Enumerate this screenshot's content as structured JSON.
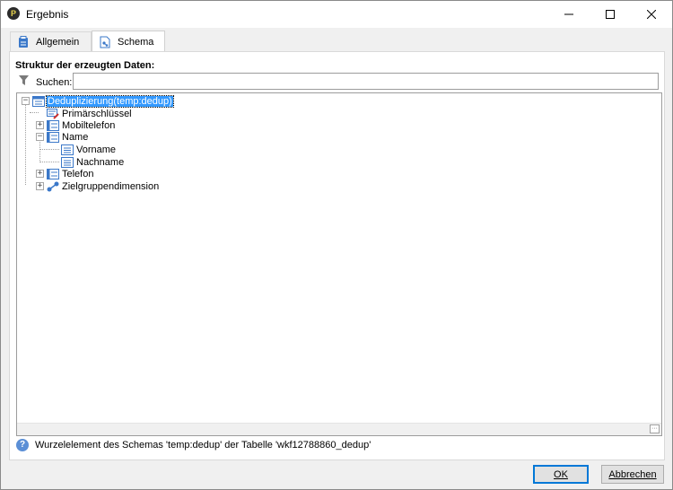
{
  "window": {
    "title": "Ergebnis",
    "app_icon_glyph": "P",
    "icon": "app-logo-icon"
  },
  "tabs": [
    {
      "label": "Allgemein",
      "icon": "clipboard-icon",
      "active": false
    },
    {
      "label": "Schema",
      "icon": "schema-icon",
      "active": true
    }
  ],
  "schema": {
    "section_title": "Struktur der erzeugten Daten:",
    "search": {
      "label": "Suchen:",
      "value": "",
      "placeholder": ""
    },
    "tree": [
      {
        "label": "Deduplizierung(temp:dedup)",
        "icon": "table-element-icon",
        "expanded": true,
        "selected": true,
        "level": 0
      },
      {
        "label": "Primärschlüssel",
        "icon": "primary-key-icon",
        "expanded": null,
        "selected": false,
        "level": 1
      },
      {
        "label": "Mobiltelefon",
        "icon": "element-icon",
        "expanded": false,
        "selected": false,
        "level": 1
      },
      {
        "label": "Name",
        "icon": "element-icon",
        "expanded": true,
        "selected": false,
        "level": 1
      },
      {
        "label": "Vorname",
        "icon": "field-icon",
        "expanded": null,
        "selected": false,
        "level": 2
      },
      {
        "label": "Nachname",
        "icon": "field-icon",
        "expanded": null,
        "selected": false,
        "level": 2
      },
      {
        "label": "Telefon",
        "icon": "element-icon",
        "expanded": false,
        "selected": false,
        "level": 1
      },
      {
        "label": "Zielgruppendimension",
        "icon": "link-icon",
        "expanded": false,
        "selected": false,
        "level": 1
      }
    ],
    "status_text": "Wurzelelement des Schemas 'temp:dedup' der Tabelle 'wkf12788860_dedup'"
  },
  "buttons": {
    "ok": "OK",
    "cancel": "Abbrechen"
  },
  "colors": {
    "selection": "#3399ff",
    "default_button_border": "#0078d7"
  }
}
